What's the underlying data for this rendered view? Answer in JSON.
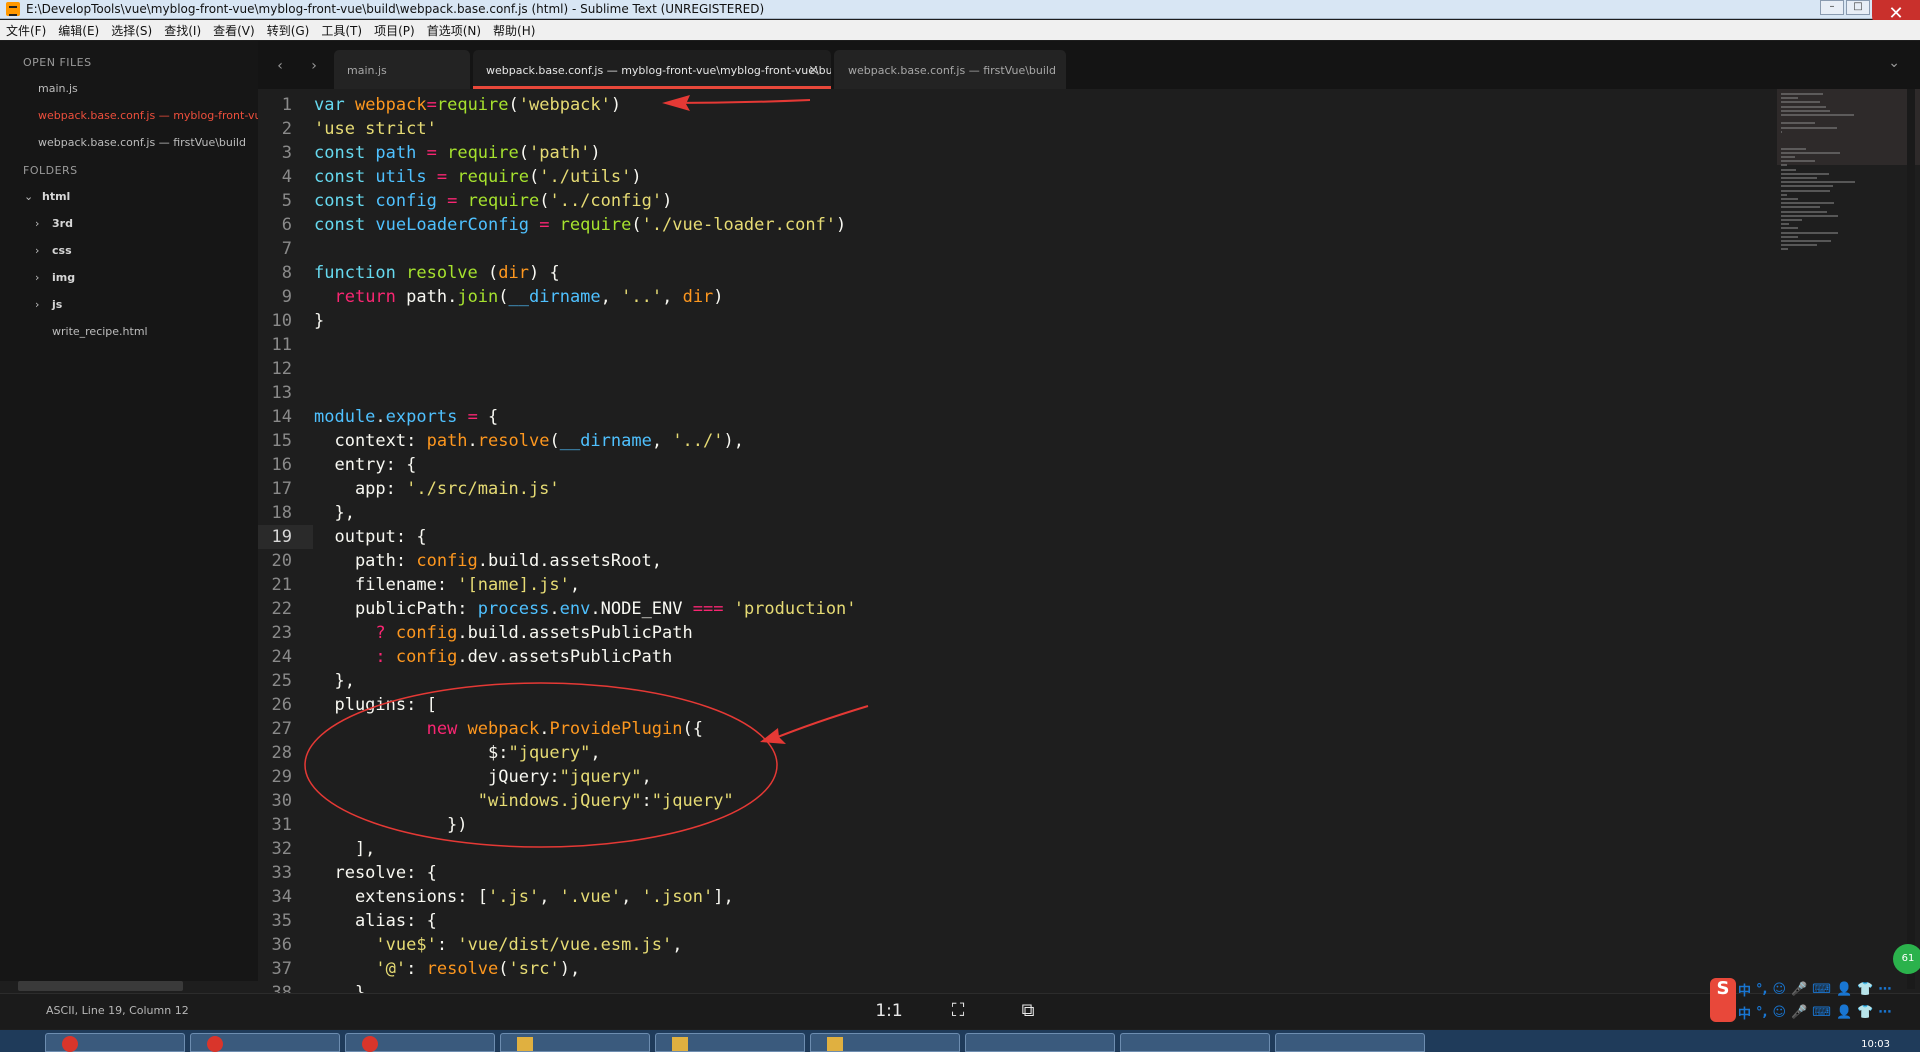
{
  "window": {
    "title": "E:\\DevelopTools\\vue\\myblog-front-vue\\myblog-front-vue\\build\\webpack.base.conf.js (html) - Sublime Text (UNREGISTERED)",
    "minimize": "–",
    "maximize": "□",
    "close": "✕"
  },
  "menu": [
    "文件(F)",
    "编辑(E)",
    "选择(S)",
    "查找(I)",
    "查看(V)",
    "转到(G)",
    "工具(T)",
    "项目(P)",
    "首选项(N)",
    "帮助(H)"
  ],
  "sidebar": {
    "open_files_heading": "OPEN FILES",
    "open_files": [
      {
        "label": "main.js"
      },
      {
        "label": "webpack.base.conf.js — myblog-front-vue\\myblog-front-vue\\build"
      },
      {
        "label": "webpack.base.conf.js — firstVue\\build"
      }
    ],
    "folders_heading": "FOLDERS",
    "root_folder": "html",
    "folders": [
      "3rd",
      "css",
      "img",
      "js"
    ],
    "files": [
      "write_recipe.html"
    ]
  },
  "tabs": [
    {
      "label": "main.js"
    },
    {
      "label": "webpack.base.conf.js — myblog-front-vue\\myblog-front-vue\\build",
      "close": "×"
    },
    {
      "label": "webpack.base.conf.js — firstVue\\build"
    }
  ],
  "tab_nav": {
    "prev": "‹",
    "next": "›",
    "menu": "⌄"
  },
  "editor": {
    "current_line": 19,
    "lines": [
      [
        [
          "k",
          "var "
        ],
        [
          "v",
          "webpack"
        ],
        [
          "kr",
          "="
        ],
        [
          "f",
          "require"
        ],
        [
          "",
          "("
        ],
        [
          "s",
          "'webpack'"
        ],
        [
          "",
          ")"
        ]
      ],
      [
        [
          "s",
          "'use strict'"
        ]
      ],
      [
        [
          "k",
          "const "
        ],
        [
          "b",
          "path"
        ],
        [
          "kr",
          " = "
        ],
        [
          "f",
          "require"
        ],
        [
          "",
          "("
        ],
        [
          "s",
          "'path'"
        ],
        [
          "",
          ")"
        ]
      ],
      [
        [
          "k",
          "const "
        ],
        [
          "b",
          "utils"
        ],
        [
          "kr",
          " = "
        ],
        [
          "f",
          "require"
        ],
        [
          "",
          "("
        ],
        [
          "s",
          "'./utils'"
        ],
        [
          "",
          ")"
        ]
      ],
      [
        [
          "k",
          "const "
        ],
        [
          "b",
          "config"
        ],
        [
          "kr",
          " = "
        ],
        [
          "f",
          "require"
        ],
        [
          "",
          "("
        ],
        [
          "s",
          "'../config'"
        ],
        [
          "",
          ")"
        ]
      ],
      [
        [
          "k",
          "const "
        ],
        [
          "b",
          "vueLoaderConfig"
        ],
        [
          "kr",
          " = "
        ],
        [
          "f",
          "require"
        ],
        [
          "",
          "("
        ],
        [
          "s",
          "'./vue-loader.conf'"
        ],
        [
          "",
          ")"
        ]
      ],
      [],
      [
        [
          "k",
          "function "
        ],
        [
          "f",
          "resolve"
        ],
        [
          "",
          " ("
        ],
        [
          "v",
          "dir"
        ],
        [
          "",
          ") {"
        ]
      ],
      [
        [
          "",
          "  "
        ],
        [
          "kr",
          "return "
        ],
        [
          "",
          "path."
        ],
        [
          "f",
          "join"
        ],
        [
          "",
          "("
        ],
        [
          "b",
          "__dirname"
        ],
        [
          "",
          ", "
        ],
        [
          "s",
          "'..'"
        ],
        [
          "",
          ", "
        ],
        [
          "v",
          "dir"
        ],
        [
          "",
          ")"
        ]
      ],
      [
        [
          "",
          "}"
        ]
      ],
      [],
      [],
      [],
      [
        [
          "b",
          "module"
        ],
        [
          "",
          "."
        ],
        [
          "b",
          "exports"
        ],
        [
          "kr",
          " = "
        ],
        [
          "",
          "{"
        ]
      ],
      [
        [
          "",
          "  context: "
        ],
        [
          "v",
          "path"
        ],
        [
          "",
          "."
        ],
        [
          "v",
          "resolve"
        ],
        [
          "",
          "("
        ],
        [
          "b",
          "__dirname"
        ],
        [
          "",
          ", "
        ],
        [
          "s",
          "'../'"
        ],
        [
          "",
          "),"
        ]
      ],
      [
        [
          "",
          "  entry: {"
        ]
      ],
      [
        [
          "",
          "    app: "
        ],
        [
          "s",
          "'./src/main.js'"
        ]
      ],
      [
        [
          "",
          "  },"
        ]
      ],
      [
        [
          "",
          "  output: {"
        ]
      ],
      [
        [
          "",
          "    path: "
        ],
        [
          "v",
          "config"
        ],
        [
          "",
          ".build.assetsRoot,"
        ]
      ],
      [
        [
          "",
          "    filename: "
        ],
        [
          "s",
          "'[name].js'"
        ],
        [
          "",
          ","
        ]
      ],
      [
        [
          "",
          "    publicPath: "
        ],
        [
          "b",
          "process"
        ],
        [
          "",
          "."
        ],
        [
          "b",
          "env"
        ],
        [
          "",
          ".NODE_ENV "
        ],
        [
          "kr",
          "==="
        ],
        [
          "s",
          " 'production'"
        ]
      ],
      [
        [
          "",
          "      "
        ],
        [
          "kr",
          "? "
        ],
        [
          "v",
          "config"
        ],
        [
          "",
          ".build.assetsPublicPath"
        ]
      ],
      [
        [
          "",
          "      "
        ],
        [
          "kr",
          ": "
        ],
        [
          "v",
          "config"
        ],
        [
          "",
          ".dev.assetsPublicPath"
        ]
      ],
      [
        [
          "",
          "  },"
        ]
      ],
      [
        [
          "",
          "  plugins: ["
        ]
      ],
      [
        [
          "",
          "           "
        ],
        [
          "kr",
          "new "
        ],
        [
          "v",
          "webpack"
        ],
        [
          "",
          "."
        ],
        [
          "v",
          "ProvidePlugin"
        ],
        [
          "",
          "({"
        ]
      ],
      [
        [
          "",
          "                 $:"
        ],
        [
          "s",
          "\"jquery\""
        ],
        [
          "",
          ","
        ]
      ],
      [
        [
          "",
          "                 jQuery:"
        ],
        [
          "s",
          "\"jquery\""
        ],
        [
          "",
          ","
        ]
      ],
      [
        [
          "",
          "                "
        ],
        [
          "s",
          "\"windows.jQuery\""
        ],
        [
          "",
          ":"
        ],
        [
          "s",
          "\"jquery\""
        ]
      ],
      [
        [
          "",
          "             })"
        ]
      ],
      [
        [
          "",
          "    ],"
        ]
      ],
      [
        [
          "",
          "  resolve: {"
        ]
      ],
      [
        [
          "",
          "    extensions: ["
        ],
        [
          "s",
          "'.js'"
        ],
        [
          "",
          ", "
        ],
        [
          "s",
          "'.vue'"
        ],
        [
          "",
          ", "
        ],
        [
          "s",
          "'.json'"
        ],
        [
          "",
          "],"
        ]
      ],
      [
        [
          "",
          "    alias: {"
        ]
      ],
      [
        [
          "",
          "      "
        ],
        [
          "s",
          "'vue$'"
        ],
        [
          "",
          ": "
        ],
        [
          "s",
          "'vue/dist/vue.esm.js'"
        ],
        [
          "",
          ","
        ]
      ],
      [
        [
          "",
          "      "
        ],
        [
          "s",
          "'@'"
        ],
        [
          "",
          ": "
        ],
        [
          "v",
          "resolve"
        ],
        [
          "",
          "("
        ],
        [
          "s",
          "'src'"
        ],
        [
          "",
          "),"
        ]
      ],
      [
        [
          "",
          "    }"
        ]
      ]
    ]
  },
  "status": {
    "text": "ASCII, Line 19, Column 12"
  },
  "viewer": {
    "actual_size": "1:1",
    "fit": "⛶",
    "window": "⧉"
  },
  "ime": {
    "logo": "S",
    "badge": "61",
    "row1": [
      "中",
      "°,",
      "☺",
      "🎤",
      "⌨",
      "👤",
      "👕",
      "⋯"
    ],
    "row2": [
      "中",
      "°,",
      "☺",
      "🎤",
      "⌨",
      "👤",
      "👕",
      "⋯"
    ]
  },
  "taskbar": {
    "clock": "10:03"
  },
  "colors": {
    "accent": "#e8483a",
    "keyword": "#66d9ef",
    "string": "#e6db74",
    "function": "#a6e22e",
    "variable": "#fd971f"
  }
}
